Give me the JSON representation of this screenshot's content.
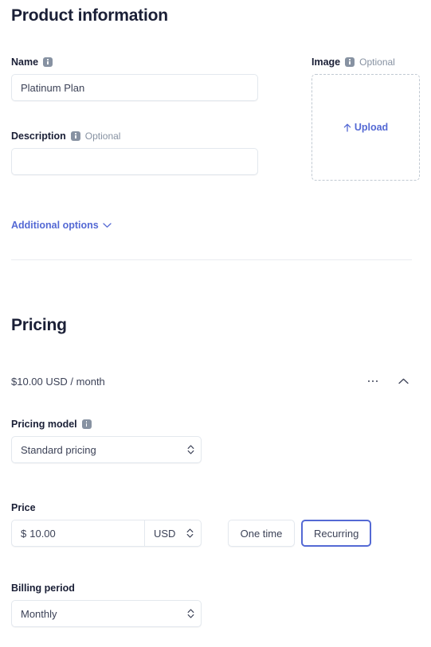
{
  "product_section": {
    "title": "Product information",
    "name_field": {
      "label": "Name",
      "value": "Platinum Plan",
      "placeholder": ""
    },
    "description_field": {
      "label": "Description",
      "optional": "Optional",
      "value": "",
      "placeholder": ""
    },
    "image_field": {
      "label": "Image",
      "optional": "Optional",
      "upload_label": "Upload"
    },
    "additional_options_label": "Additional options"
  },
  "pricing_section": {
    "title": "Pricing",
    "summary": "$10.00 USD / month",
    "pricing_model": {
      "label": "Pricing model",
      "value": "Standard pricing",
      "options": [
        "Standard pricing"
      ]
    },
    "price": {
      "label": "Price",
      "currency_symbol": "$",
      "amount": "10.00",
      "currency": "USD",
      "currency_options": [
        "USD"
      ]
    },
    "billing_type": {
      "one_time_label": "One time",
      "recurring_label": "Recurring",
      "selected": "Recurring"
    },
    "billing_period": {
      "label": "Billing period",
      "value": "Monthly",
      "options": [
        "Monthly"
      ]
    }
  },
  "colors": {
    "accent": "#5469d4",
    "text": "#1a1f36",
    "muted": "#8792a2",
    "border": "#e3e8ee"
  }
}
